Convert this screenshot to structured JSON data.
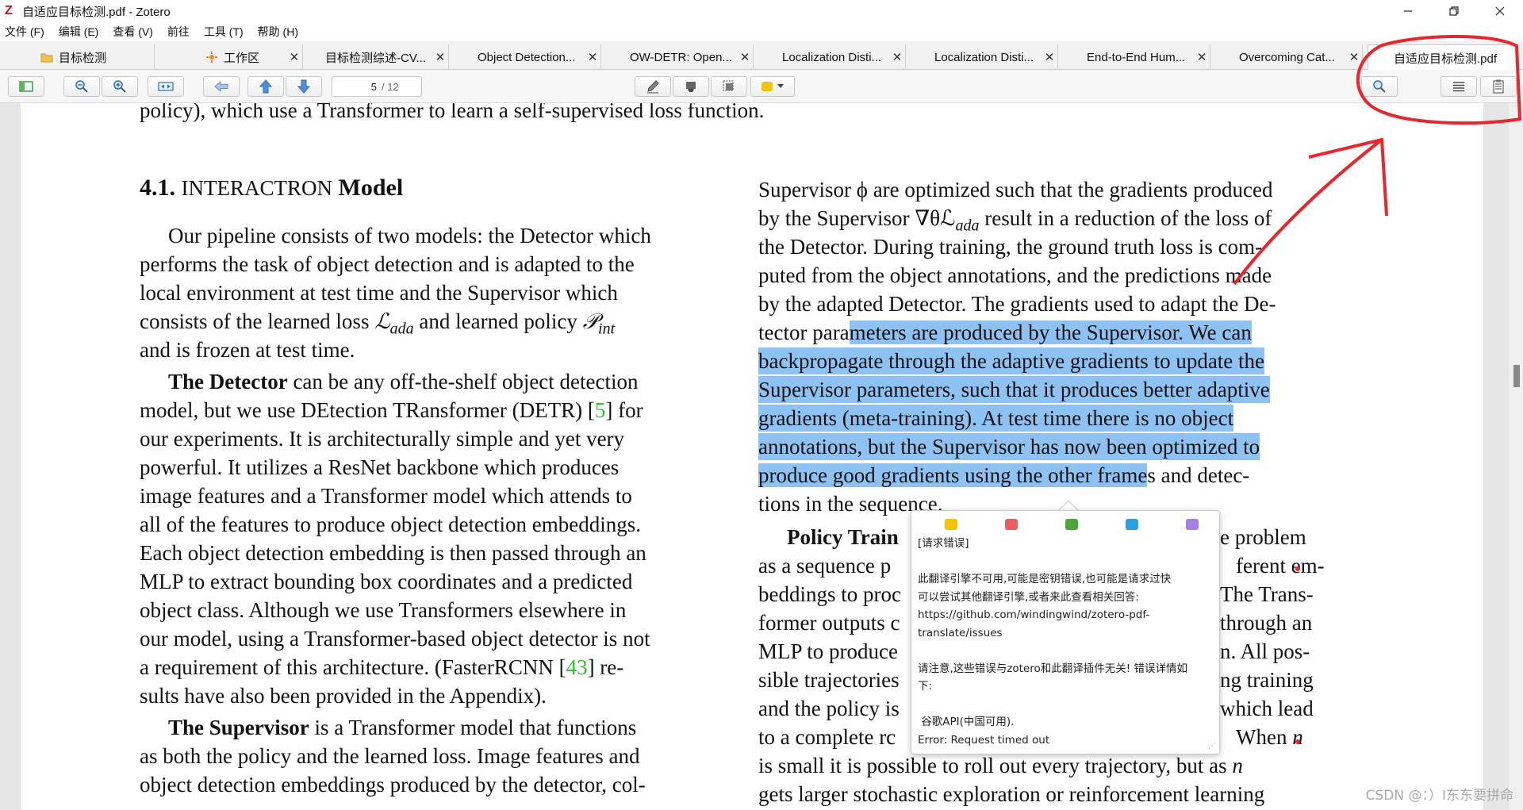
{
  "window": {
    "title": "自适应目标检测.pdf - Zotero",
    "logo": "Z",
    "controls": [
      "minimize-icon",
      "restore-icon",
      "close-icon"
    ]
  },
  "menu": [
    "文件 (F)",
    "编辑 (E)",
    "查看 (V)",
    "前往",
    "工具 (T)",
    "帮助 (H)"
  ],
  "tabs": [
    {
      "label": "目标检测",
      "icon": "folder-icon"
    },
    {
      "label": "工作区",
      "icon": "workspace-icon"
    },
    {
      "label": "目标检测综述-CV..."
    },
    {
      "label": "Object Detection..."
    },
    {
      "label": "OW-DETR: Open..."
    },
    {
      "label": "Localization Disti..."
    },
    {
      "label": "Localization Disti..."
    },
    {
      "label": "End-to-End Hum..."
    },
    {
      "label": "Overcoming Cat..."
    },
    {
      "label": "自适应目标检测.pdf",
      "active": true
    }
  ],
  "toolbar": {
    "page_current": "5",
    "page_total": "/ 12",
    "highlight_color": "#f5c400"
  },
  "document": {
    "left_column": {
      "top_line": "policy), which use a Transformer to learn a self-supervised loss function.",
      "heading_num": "4.1.",
      "heading_word1": "INTERACTRON",
      "heading_word2": "Model",
      "p1": [
        "Our pipeline consists of two models: the Detector which",
        "performs the task of object detection and is adapted to the",
        "local environment at test time and the Supervisor which",
        "consists of the learned loss ",
        "ℒ",
        "ada",
        " and learned policy ",
        "𝒫",
        "int",
        "and is frozen at test time."
      ],
      "p2_lead": "The Detector",
      "p2_first_rest": " can be any off-the-shelf object detection",
      "p2_line2a": "model, but we use DEtection TRansformer (DETR) [",
      "p2_ref1": "5",
      "p2_line2b": "] for",
      "p2_lines": [
        "our experiments.  It is architecturally simple and yet very",
        "powerful.  It utilizes a ResNet backbone which produces",
        "image features and a Transformer model which attends to",
        "all of the features to produce object detection embeddings.",
        "Each object detection embedding is then passed through an",
        "MLP to extract bounding box coordinates and a predicted",
        "object class.  Although we use Transformers elsewhere in",
        "our model, using a Transformer-based object detector is not"
      ],
      "p2_line11a": "a requirement of this architecture.  (FasterRCNN [",
      "p2_ref2": "43",
      "p2_line11b": "] re-",
      "p2_last": "sults have also been provided in the Appendix).",
      "p3_lead": "The Supervisor",
      "p3_first_rest": " is a Transformer model that functions",
      "p3_lines": [
        "as both the policy and the learned loss. Image features and",
        "object detection embeddings produced by the detector, col-"
      ]
    },
    "right_column": {
      "lines": [
        "Supervisor ϕ are optimized such that the gradients produced",
        "by the Supervisor ∇θℒ",
        "ada",
        " result in a reduction of the loss of",
        "the Detector. During training, the ground truth loss is com-",
        "puted from the object annotations, and the predictions made",
        "by the adapted Detector. The gradients used to adapt the De-"
      ],
      "hl_pre": "tector para",
      "hl_lines": [
        "meters are produced by the Supervisor.  We can",
        "backpropagate through the adaptive gradients to update the",
        "Supervisor parameters, such that it produces better adaptive",
        "gradients (meta-training).  At test time there is no object",
        "annotations, but the Supervisor has now been optimized to",
        "produce good gradients using the other frame"
      ],
      "hl_post": "s and detec-",
      "after": "tions in the sequence.",
      "pt_lead": "Policy Train",
      "pt_fragments": [
        "e problem",
        "ferent em-",
        "The Trans-",
        "through an",
        "n. All pos-",
        "ng training",
        "which lead"
      ],
      "pt_left_fragments": [
        "as a sequence p",
        "beddings to proc",
        "former outputs c",
        "MLP to produce",
        "sible trajectories",
        "and the policy is",
        "to a complete rc"
      ],
      "when_n": "When ",
      "n_var": "n",
      "bottom_lines": [
        "is small it is possible to roll out every trajectory, but as ",
        "gets larger stochastic exploration or reinforcement learning"
      ]
    }
  },
  "popup": {
    "swatch_colors": [
      "#f5c400",
      "#e85d5d",
      "#4ca63c",
      "#2f9ee0",
      "#a57ee8"
    ],
    "body": "[请求错误]\n\n此翻译引擎不可用,可能是密钥错误,也可能是请求过快\n可以尝试其他翻译引擎,或者来此查看相关回答:\nhttps://github.com/windingwind/zotero-pdf-\ntranslate/issues\n\n请注意,这些错误与zotero和此翻译插件无关! 错误详情如\n下:\n\n 谷歌API(中国可用).\nError: Request timed out"
  },
  "watermark": "CSDN @：）I东东要拼命"
}
